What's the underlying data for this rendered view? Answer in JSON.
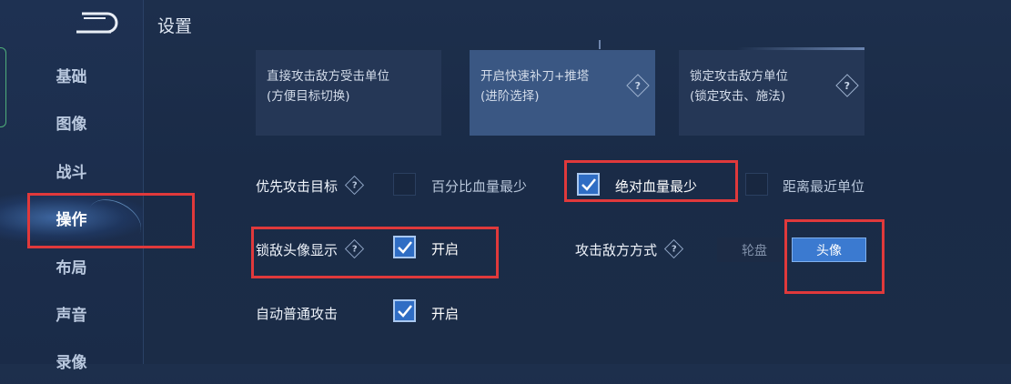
{
  "header": {
    "title": "设置"
  },
  "sidebar": {
    "items": [
      {
        "label": "基础"
      },
      {
        "label": "图像"
      },
      {
        "label": "战斗"
      },
      {
        "label": "操作"
      },
      {
        "label": "布局"
      },
      {
        "label": "声音"
      },
      {
        "label": "录像"
      }
    ],
    "active": "操作"
  },
  "cards": [
    {
      "line1": "直接攻击敌方受击单位",
      "line2": "(方便目标切换)",
      "selected": false
    },
    {
      "line1": "开启快速补刀+推塔",
      "line2": "(进阶选择)",
      "selected": true
    },
    {
      "line1": "锁定攻击敌方单位",
      "line2": "(锁定攻击、施法)",
      "selected": false
    }
  ],
  "help_glyph": "?",
  "priority": {
    "label": "优先攻击目标",
    "options": [
      {
        "label": "百分比血量最少",
        "checked": false
      },
      {
        "label": "绝对血量最少",
        "checked": true
      },
      {
        "label": "距离最近单位",
        "checked": false
      }
    ]
  },
  "lock_portrait": {
    "label": "锁敌头像显示",
    "option": "开启",
    "checked": true
  },
  "attack_mode": {
    "label": "攻击敌方方式",
    "options": [
      "轮盘",
      "头像"
    ],
    "selected": "头像"
  },
  "auto_attack": {
    "label": "自动普通攻击",
    "option": "开启",
    "checked": true
  },
  "colors": {
    "accent": "#3b7ad0",
    "annotation": "#e0393b",
    "background": "#1b2c47"
  }
}
